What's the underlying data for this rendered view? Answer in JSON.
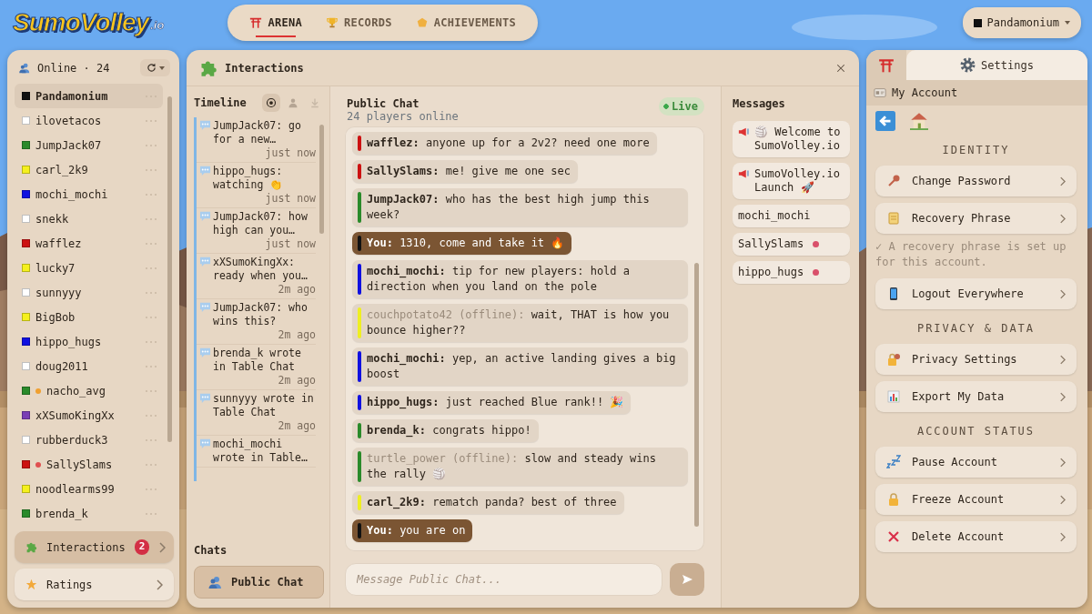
{
  "header": {
    "logo": "SumoVolley",
    "logo_suffix": ".io",
    "tabs": [
      {
        "label": "ARENA",
        "selected": true
      },
      {
        "label": "RECORDS",
        "selected": false
      },
      {
        "label": "ACHIEVEMENTS",
        "selected": false
      }
    ],
    "account": {
      "label": "Pandamonium",
      "color": "#111111"
    }
  },
  "online": {
    "title": "Online · 24",
    "users": [
      {
        "name": "Pandamonium",
        "color": "#111111",
        "selected": true
      },
      {
        "name": "ilovetacos",
        "color": "#ffffff",
        "selected": false
      },
      {
        "name": "JumpJack07",
        "color": "#2a8a2a",
        "selected": false
      },
      {
        "name": "carl_2k9",
        "color": "#f5f01e",
        "selected": false
      },
      {
        "name": "mochi_mochi",
        "color": "#1010e0",
        "selected": false
      },
      {
        "name": "snekk",
        "color": "#ffffff",
        "selected": false
      },
      {
        "name": "wafflez",
        "color": "#cc1111",
        "selected": false
      },
      {
        "name": "lucky7",
        "color": "#f5f01e",
        "selected": false
      },
      {
        "name": "sunnyyy",
        "color": "#ffffff",
        "selected": false
      },
      {
        "name": "BigBob",
        "color": "#f5f01e",
        "selected": false
      },
      {
        "name": "hippo_hugs",
        "color": "#1010e0",
        "selected": false
      },
      {
        "name": "doug2011",
        "color": "#ffffff",
        "selected": false
      },
      {
        "name": "nacho_avg",
        "color": "#2a8a2a",
        "status_dot": {
          "color": "#f0a030"
        },
        "selected": false
      },
      {
        "name": "xXSumoKingXx",
        "color": "#7a3fb5",
        "selected": false
      },
      {
        "name": "rubberduck3",
        "color": "#ffffff",
        "selected": false
      },
      {
        "name": "SallySlams",
        "color": "#cc1111",
        "status_dot": {
          "color": "#e05050"
        },
        "selected": false
      },
      {
        "name": "noodlearms99",
        "color": "#f5f01e",
        "selected": false
      },
      {
        "name": "brenda_k",
        "color": "#2a8a2a",
        "selected": false
      }
    ]
  },
  "sidebar_buttons": [
    {
      "label": "Interactions",
      "badge": "2",
      "selected": true
    },
    {
      "label": "Ratings",
      "selected": false
    }
  ],
  "interactions": {
    "title": "Interactions",
    "timeline": {
      "title": "Timeline",
      "filters": [
        {
          "selected": true
        },
        {
          "selected": false
        },
        {
          "selected": false
        }
      ],
      "items": [
        {
          "text": "JumpJack07: go for a new…",
          "time": "just now"
        },
        {
          "text": "hippo_hugs: watching 👏",
          "time": "just now"
        },
        {
          "text": "JumpJack07: how high can you…",
          "time": "just now"
        },
        {
          "text": "xXSumoKingXx: ready when you…",
          "time": "2m ago"
        },
        {
          "text": "JumpJack07: who wins this?",
          "time": "2m ago"
        },
        {
          "text": "brenda_k wrote in Table Chat",
          "time": "2m ago"
        },
        {
          "text": "sunnyyy wrote in Table Chat",
          "time": "2m ago"
        },
        {
          "text": "mochi_mochi wrote in Table…"
        }
      ]
    },
    "chats": {
      "title": "Chats",
      "items": [
        {
          "label": "Public Chat",
          "selected": true
        }
      ]
    },
    "chat": {
      "title": "Public Chat",
      "subtitle": "24 players online",
      "live": "Live",
      "messages": [
        {
          "author": "wafflez:",
          "text": "anyone up for a 2v2? need one more",
          "color": "#cc1111",
          "mine": false,
          "offline": false
        },
        {
          "author": "SallySlams:",
          "text": "me! give me one sec",
          "color": "#cc1111",
          "mine": false,
          "offline": false
        },
        {
          "author": "JumpJack07:",
          "text": "who has the best high jump this week?",
          "color": "#2a8a2a",
          "mine": false,
          "offline": false
        },
        {
          "author": "You:",
          "text": "1310, come and take it 🔥",
          "color": "#111111",
          "mine": true,
          "offline": false
        },
        {
          "author": "mochi_mochi:",
          "text": "tip for new players: hold a direction when you land on the pole",
          "color": "#1010e0",
          "mine": false,
          "offline": false
        },
        {
          "author": "couchpotato42 (offline):",
          "text": "wait, THAT is how you bounce higher??",
          "color": "#eeee22",
          "mine": false,
          "offline": true
        },
        {
          "author": "mochi_mochi:",
          "text": "yep, an active landing gives a big boost",
          "color": "#1010e0",
          "mine": false,
          "offline": false
        },
        {
          "author": "hippo_hugs:",
          "text": "just reached Blue rank!! 🎉",
          "color": "#1010e0",
          "mine": false,
          "offline": false
        },
        {
          "author": "brenda_k:",
          "text": "congrats hippo!",
          "color": "#2a8a2a",
          "mine": false,
          "offline": false
        },
        {
          "author": "turtle_power (offline):",
          "text": "slow and steady wins the rally 🏐",
          "color": "#2a8a2a",
          "mine": false,
          "offline": true
        },
        {
          "author": "carl_2k9:",
          "text": "rematch panda? best of three",
          "color": "#eeee22",
          "mine": false,
          "offline": false
        },
        {
          "author": "You:",
          "text": "you are on",
          "color": "#111111",
          "mine": true,
          "offline": false
        }
      ],
      "input": {
        "placeholder": "Message Public Chat..."
      }
    },
    "messages": {
      "title": "Messages",
      "items": [
        {
          "kind": "announcement",
          "text": "🏐 Welcome to SumoVolley.io"
        },
        {
          "kind": "announcement",
          "text": "SumoVolley.io Launch 🚀"
        },
        {
          "kind": "dm",
          "text": "mochi_mochi",
          "unread": false
        },
        {
          "kind": "dm",
          "text": "SallySlams",
          "unread": true
        },
        {
          "kind": "dm",
          "text": "hippo_hugs",
          "unread": true
        }
      ]
    }
  },
  "settings": {
    "tabs": [
      {
        "kind": "arena",
        "selected": false
      },
      {
        "kind": "settings",
        "label": "Settings",
        "selected": true
      }
    ],
    "section": "My Account",
    "groups": [
      {
        "title": "IDENTITY",
        "items": [
          {
            "label": "Change Password"
          },
          {
            "label": "Recovery Phrase",
            "note": "✓ A recovery phrase is set up for this account."
          },
          {
            "label": "Logout Everywhere"
          }
        ]
      },
      {
        "title": "PRIVACY & DATA",
        "items": [
          {
            "label": "Privacy Settings"
          },
          {
            "label": "Export My Data"
          }
        ]
      },
      {
        "title": "ACCOUNT STATUS",
        "items": [
          {
            "label": "Pause Account"
          },
          {
            "label": "Freeze Account"
          },
          {
            "label": "Delete Account"
          }
        ]
      }
    ]
  }
}
